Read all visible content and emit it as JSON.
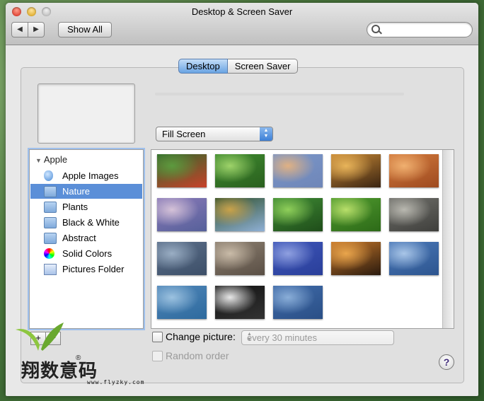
{
  "window": {
    "title": "Desktop & Screen Saver"
  },
  "toolbar": {
    "back_icon": "chevron-left-icon",
    "forward_icon": "chevron-right-icon",
    "show_all_label": "Show All",
    "search": {
      "value": "",
      "placeholder": ""
    }
  },
  "tabs": [
    {
      "label": "Desktop",
      "selected": true
    },
    {
      "label": "Screen Saver",
      "selected": false
    }
  ],
  "fill_mode": {
    "selected": "Fill Screen"
  },
  "sidebar": {
    "group": "Apple",
    "items": [
      {
        "label": "Apple Images",
        "icon": "apple-icon",
        "selected": false
      },
      {
        "label": "Nature",
        "icon": "folder-icon",
        "selected": true
      },
      {
        "label": "Plants",
        "icon": "folder-icon",
        "selected": false
      },
      {
        "label": "Black & White",
        "icon": "folder-icon",
        "selected": false
      },
      {
        "label": "Abstract",
        "icon": "folder-icon",
        "selected": false
      },
      {
        "label": "Solid Colors",
        "icon": "color-wheel-icon",
        "selected": false
      },
      {
        "label": "Pictures Folder",
        "icon": "pictures-folder-icon",
        "selected": false
      }
    ],
    "add_label": "+",
    "remove_label": "−"
  },
  "thumbnails": [
    {
      "name": "ladybugs-on-leaves",
      "colors": [
        "#2f6b2c",
        "#5c9a3e",
        "#c8402a"
      ]
    },
    {
      "name": "green-dew-drop",
      "colors": [
        "#3e8a2f",
        "#9ed36a",
        "#2a5f1e"
      ]
    },
    {
      "name": "sunset-water",
      "colors": [
        "#7a96c8",
        "#e0b183",
        "#6f86b8"
      ]
    },
    {
      "name": "leopard-fur",
      "colors": [
        "#c98a36",
        "#e8b45a",
        "#3a2412"
      ]
    },
    {
      "name": "sandstone-waves",
      "colors": [
        "#d27a3c",
        "#f0b070",
        "#9e4a20"
      ]
    },
    {
      "name": "purple-dunes",
      "colors": [
        "#8a7ab8",
        "#d5c2d8",
        "#56609a"
      ]
    },
    {
      "name": "golden-pavilion",
      "colors": [
        "#2e4f2a",
        "#c9a24a",
        "#8fb0d6"
      ]
    },
    {
      "name": "ladybug-on-stem",
      "colors": [
        "#3f8b34",
        "#8fcf5a",
        "#1f4d1a"
      ]
    },
    {
      "name": "ladybug-on-leaf",
      "colors": [
        "#4f9a2e",
        "#b8df6a",
        "#2d6a18"
      ]
    },
    {
      "name": "zen-garden-stones",
      "colors": [
        "#6f6f6a",
        "#b9b8b0",
        "#3f3f3c"
      ]
    },
    {
      "name": "blue-grey-dunes",
      "colors": [
        "#5b6f8a",
        "#9aaec4",
        "#3d4f68"
      ]
    },
    {
      "name": "river-pebbles",
      "colors": [
        "#8c7f70",
        "#c9bba8",
        "#5a4f45"
      ]
    },
    {
      "name": "blue-ripples",
      "colors": [
        "#3d55b8",
        "#8fa0e0",
        "#2a3f9a"
      ]
    },
    {
      "name": "tiger-fur",
      "colors": [
        "#c7782a",
        "#e9a54c",
        "#2a1a0e"
      ]
    },
    {
      "name": "blue-lake",
      "colors": [
        "#4a78b8",
        "#a9c6e8",
        "#2d558f"
      ]
    },
    {
      "name": "misty-sea",
      "colors": [
        "#4f86b8",
        "#9cc2e0",
        "#2e6a9e"
      ]
    },
    {
      "name": "zebra-stripes",
      "colors": [
        "#111111",
        "#e8e8e8",
        "#333333"
      ]
    },
    {
      "name": "blue-sand-spiral",
      "colors": [
        "#3f6aa8",
        "#8aaed8",
        "#2a4f86"
      ]
    }
  ],
  "change_picture": {
    "label": "Change picture:",
    "checked": false,
    "interval": "every 30 minutes"
  },
  "random_order": {
    "label": "Random order",
    "checked": false,
    "enabled": false
  },
  "help": {
    "label": "?"
  },
  "watermark": {
    "text": "翔数意码",
    "registered": "®",
    "url": "www.flyzky.com"
  }
}
